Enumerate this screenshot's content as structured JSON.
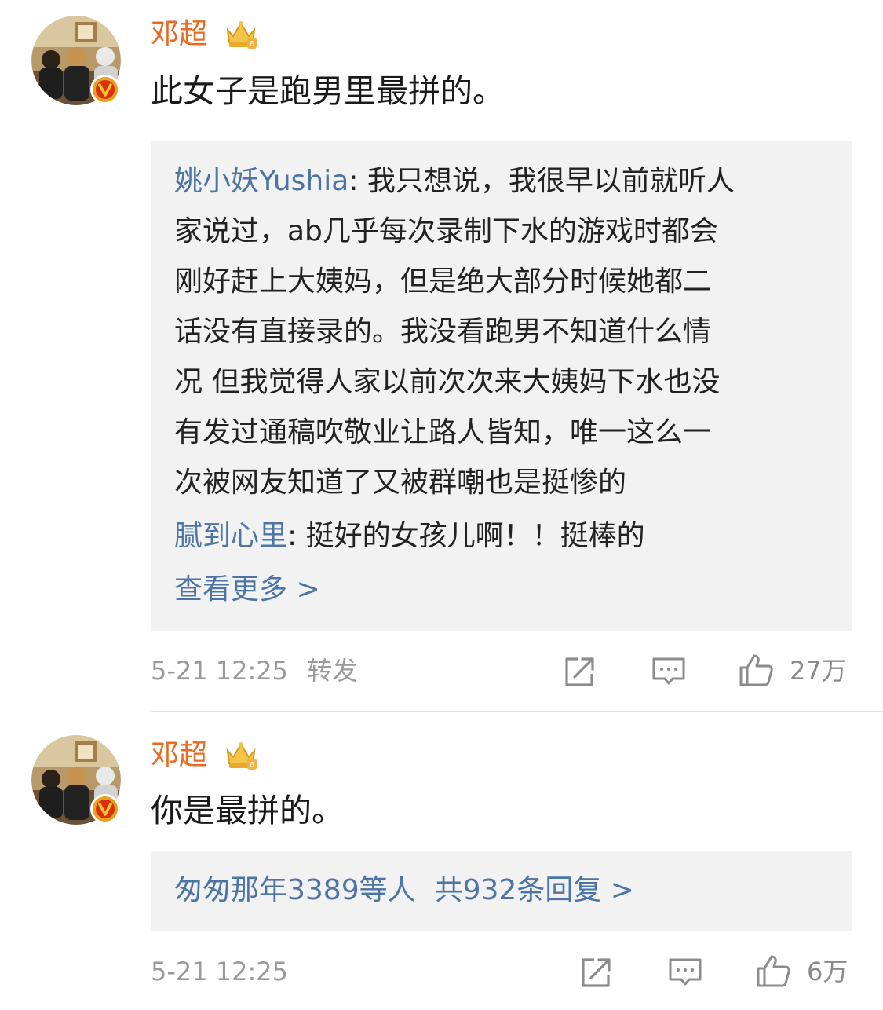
{
  "comments": [
    {
      "username": "邓超",
      "text": "此女子是跑男里最拼的。",
      "replies": [
        {
          "author": "姚小妖Yushia",
          "lines": [
            ": 我只想说，我很早以前就听人",
            "家说过，ab几乎每次录制下水的游戏时都会",
            "刚好赶上大姨妈，但是绝大部分时候她都二",
            "话没有直接录的。我没看跑男不知道什么情",
            "况 但我觉得人家以前次次来大姨妈下水也没",
            "有发过通稿吹敬业让路人皆知，唯一这么一",
            "次被网友知道了又被群嘲也是挺惨的"
          ]
        },
        {
          "author": "腻到心里",
          "lines": [
            ": 挺好的女孩儿啊！！挺棒的"
          ]
        }
      ],
      "view_more": "查看更多 >",
      "time": "5-21 12:25",
      "repost_label": "转发",
      "likes": "27万"
    },
    {
      "username": "邓超",
      "text": "你是最拼的。",
      "reply_summary_users": "匆匆那年3389等人",
      "reply_summary_count": "共932条回复 >",
      "time": "5-21 12:25",
      "likes": "6万"
    }
  ],
  "icons": {
    "vip_badge": "crown-icon",
    "verified": "verified-v-icon",
    "share": "share-icon",
    "comment": "comment-icon",
    "like": "thumbs-up-icon"
  },
  "colors": {
    "username": "#e86b23",
    "link": "#4c74a4",
    "meta": "#9a9a9a",
    "reply_bg": "#f2f2f2",
    "verified": "#e8a21a"
  }
}
